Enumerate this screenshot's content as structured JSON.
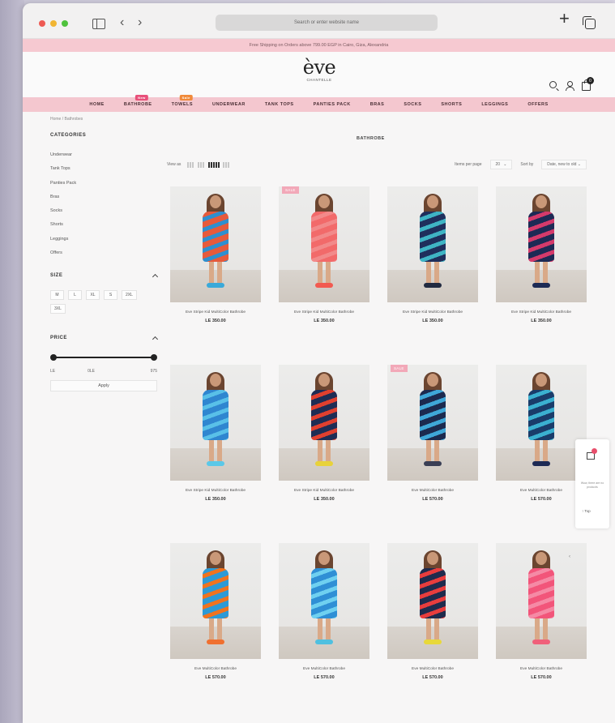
{
  "browser": {
    "address_placeholder": "Search or enter website name",
    "back_icon": "chevron-left-icon",
    "forward_icon": "chevron-right-icon",
    "plus_symbol": "+",
    "back_symbol": "‹",
    "forward_symbol": "›"
  },
  "promo": "Free Shipping on Orders above 799.00 EGP in Cairo, Giza, Alexandria",
  "logo": {
    "text": "ève",
    "sub": "CHANTELLE"
  },
  "header": {
    "cart_count": "0"
  },
  "nav": [
    {
      "label": "HOME",
      "badge": ""
    },
    {
      "label": "BATHROBE",
      "badge": "New",
      "badge_color": "#e8507a"
    },
    {
      "label": "TOWELS",
      "badge": "Sale",
      "badge_color": "#f08a3a"
    },
    {
      "label": "UNDERWEAR",
      "badge": ""
    },
    {
      "label": "TANK TOPS",
      "badge": ""
    },
    {
      "label": "PANTIES PACK",
      "badge": ""
    },
    {
      "label": "BRAS",
      "badge": ""
    },
    {
      "label": "SOCKS",
      "badge": ""
    },
    {
      "label": "SHORTS",
      "badge": ""
    },
    {
      "label": "LEGGINGS",
      "badge": ""
    },
    {
      "label": "OFFERS",
      "badge": ""
    }
  ],
  "breadcrumb": "Home / Bathrobes",
  "sidebar": {
    "categories_title": "CATEGORIES",
    "categories": [
      "Underwear",
      "Tank Tops",
      "Panties Pack",
      "Bras",
      "Socks",
      "Shorts",
      "Leggings",
      "Offers"
    ],
    "size_title": "SIZE",
    "sizes": [
      "M",
      "L",
      "XL",
      "S",
      "2XL",
      "3XL"
    ],
    "price_title": "PRICE",
    "price_from_label": "LE",
    "price_from": "0",
    "price_to_label": "LE",
    "price_to": "975",
    "apply_label": "Apply"
  },
  "main": {
    "title": "BATHROBE",
    "view_as": "View as",
    "items_per_page_label": "Items per page",
    "items_per_page": "20",
    "sort_label": "Sort by",
    "sort_value": "Date, new to old"
  },
  "products": [
    {
      "name": "Eve Stripe Kid MultiColor Bathrobe",
      "price": "LE 350.00",
      "sale": "",
      "robe": "#e65a3c",
      "robe2": "#2e8fcf",
      "feet": "#3aa9d9"
    },
    {
      "name": "Eve Stripe Kid MultiColor Bathrobe",
      "price": "LE 350.00",
      "sale": "SALE",
      "robe": "#f26a6a",
      "robe2": "#f28a8a",
      "feet": "#f25a50"
    },
    {
      "name": "Eve Stripe Kid MultiColor Bathrobe",
      "price": "LE 350.00",
      "sale": "",
      "robe": "#1f2f5c",
      "robe2": "#3fb4c4",
      "feet": "#222a40"
    },
    {
      "name": "Eve Stripe Kid MultiColor Bathrobe",
      "price": "LE 350.00",
      "sale": "",
      "robe": "#1d2a55",
      "robe2": "#d43a6b",
      "feet": "#1d2a55"
    },
    {
      "name": "Eve Stripe Kid MultiColor Bathrobe",
      "price": "LE 350.00",
      "sale": "",
      "robe": "#2f86d0",
      "robe2": "#59c0e8",
      "feet": "#5bc8e8"
    },
    {
      "name": "Eve Stripe Kid MultiColor Bathrobe",
      "price": "LE 350.00",
      "sale": "",
      "robe": "#1e2d55",
      "robe2": "#e0402f",
      "feet": "#e8d23a"
    },
    {
      "name": "Eve MultiColor Bathrobe",
      "price": "LE 570.00",
      "sale": "SALE",
      "robe": "#1c2a4f",
      "robe2": "#3fa7d8",
      "feet": "#3a3f55"
    },
    {
      "name": "Eve MultiColor Bathrobe",
      "price": "LE 570.00",
      "sale": "",
      "robe": "#1a3c6a",
      "robe2": "#3bb0d0",
      "feet": "#1d2a55"
    },
    {
      "name": "Eve MultiColor Bathrobe",
      "price": "LE 570.00",
      "sale": "",
      "robe": "#2d9ad6",
      "robe2": "#f0731f",
      "feet": "#f07030"
    },
    {
      "name": "Eve MultiColor Bathrobe",
      "price": "LE 570.00",
      "sale": "",
      "robe": "#2f8fd5",
      "robe2": "#6fd0f0",
      "feet": "#4fc0e0"
    },
    {
      "name": "Eve MultiColor Bathrobe",
      "price": "LE 570.00",
      "sale": "",
      "robe": "#1f2b4d",
      "robe2": "#e83d3d",
      "feet": "#e8d83a"
    },
    {
      "name": "Eve MultiColor Bathrobe",
      "price": "LE 570.00",
      "sale": "",
      "robe": "#f2557a",
      "robe2": "#f58aa5",
      "feet": "#f0607a"
    }
  ],
  "float_panel": {
    "text": "Wow, there are no products",
    "top_label": "Top",
    "arrow": "‹"
  }
}
